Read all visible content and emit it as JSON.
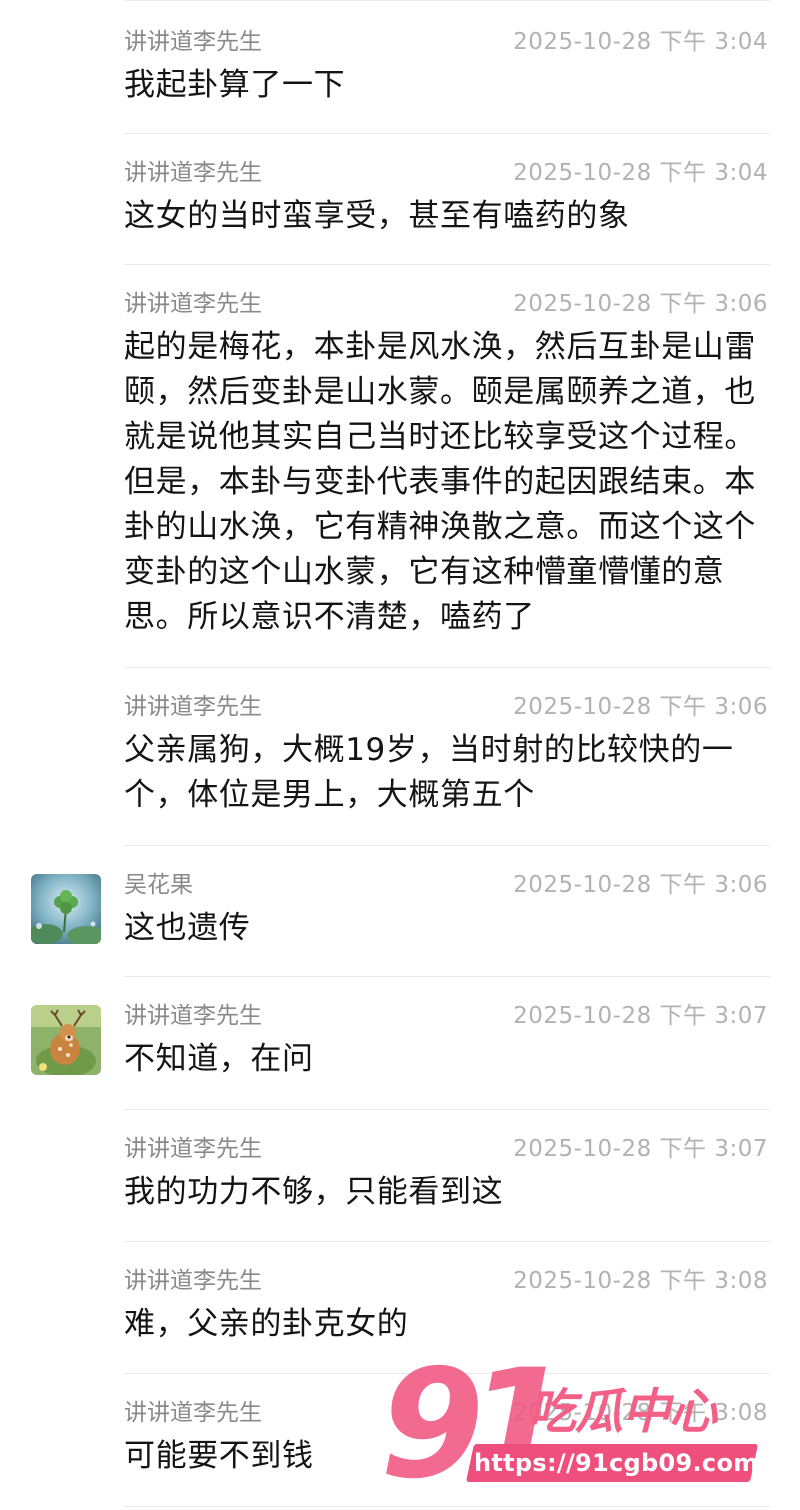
{
  "messages": [
    {
      "sender": "讲讲道李先生",
      "time": "2025-10-28 下午 3:04",
      "text": "我起卦算了一下",
      "avatar": null
    },
    {
      "sender": "讲讲道李先生",
      "time": "2025-10-28 下午 3:04",
      "text": "这女的当时蛮享受，甚至有嗑药的象",
      "avatar": null
    },
    {
      "sender": "讲讲道李先生",
      "time": "2025-10-28 下午 3:06",
      "text": "起的是梅花，本卦是风水涣，然后互卦是山雷颐，然后变卦是山水蒙。颐是属颐养之道，也就是说他其实自己当时还比较享受这个过程。但是，本卦与变卦代表事件的起因跟结束。本卦的山水涣，它有精神涣散之意。而这个这个变卦的这个山水蒙，它有这种懵童懵懂的意思。所以意识不清楚，嗑药了",
      "avatar": null
    },
    {
      "sender": "讲讲道李先生",
      "time": "2025-10-28 下午 3:06",
      "text": "父亲属狗，大概19岁，当时射的比较快的一个，体位是男上，大概第五个",
      "avatar": null
    },
    {
      "sender": "吴花果",
      "time": "2025-10-28 下午 3:06",
      "text": "这也遗传",
      "avatar": "clover-avatar"
    },
    {
      "sender": "讲讲道李先生",
      "time": "2025-10-28 下午 3:07",
      "text": "不知道，在问",
      "avatar": "deer-avatar"
    },
    {
      "sender": "讲讲道李先生",
      "time": "2025-10-28 下午 3:07",
      "text": "我的功力不够，只能看到这",
      "avatar": null
    },
    {
      "sender": "讲讲道李先生",
      "time": "2025-10-28 下午 3:08",
      "text": "难，父亲的卦克女的",
      "avatar": null
    },
    {
      "sender": "讲讲道李先生",
      "time": "2025-10-28 下午 3:08",
      "text": "可能要不到钱",
      "avatar": null
    }
  ],
  "watermark": {
    "number": "91",
    "brand": "吃瓜中心",
    "url": "https://91cgb09.com",
    "color": "#ef4f7c"
  }
}
